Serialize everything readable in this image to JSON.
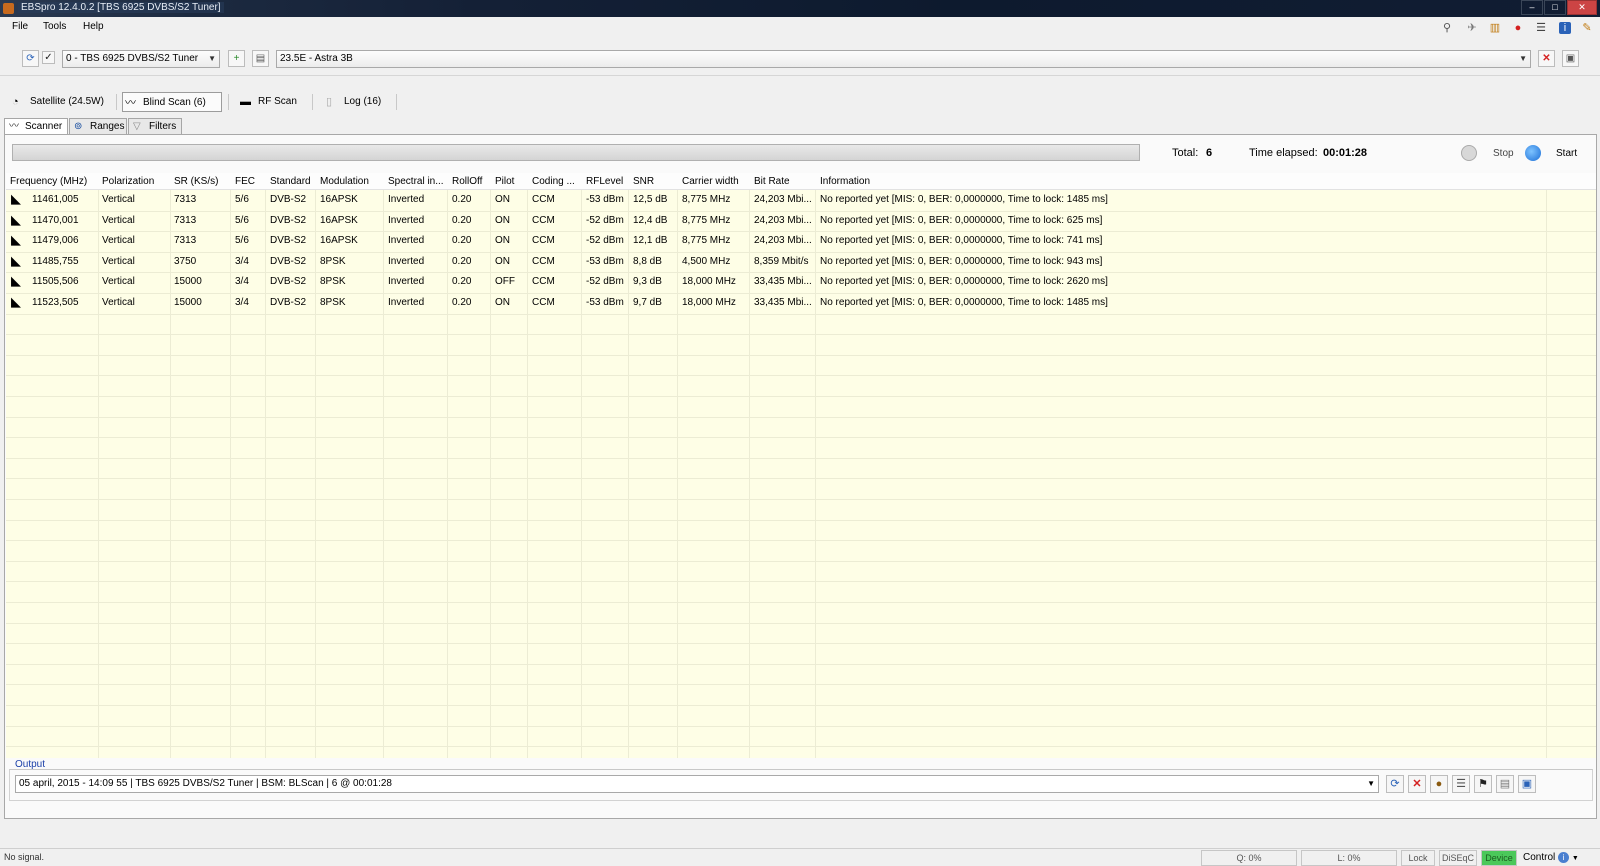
{
  "window": {
    "title": "EBSpro 12.4.0.2 [TBS 6925 DVBS/S2 Tuner]"
  },
  "menu": {
    "items": [
      "File",
      "Tools",
      "Help"
    ]
  },
  "toolbar": {
    "tuner_select": "0 - TBS 6925 DVBS/S2 Tuner",
    "satellite_select": "23.5E - Astra 3B"
  },
  "main_tabs": [
    {
      "label": "Satellite (24.5W)"
    },
    {
      "label": "Blind Scan (6)"
    },
    {
      "label": "RF Scan"
    },
    {
      "label": "Log (16)"
    }
  ],
  "sub_tabs": [
    {
      "label": "Scanner"
    },
    {
      "label": "Ranges"
    },
    {
      "label": "Filters"
    }
  ],
  "scan": {
    "progress": 0.0,
    "total_label": "Total:",
    "total_value": "6",
    "elapsed_label": "Time elapsed:",
    "elapsed_value": "00:01:28",
    "stop_label": "Stop",
    "start_label": "Start"
  },
  "table": {
    "headers": [
      "Frequency (MHz)",
      "Polarization",
      "SR (KS/s)",
      "FEC",
      "Standard",
      "Modulation",
      "Spectral in...",
      "RollOff",
      "Pilot",
      "Coding ...",
      "RFLevel",
      "SNR",
      "Carrier width",
      "Bit Rate",
      "Information"
    ],
    "rows": [
      [
        "11461,005",
        "Vertical",
        "7313",
        "5/6",
        "DVB-S2",
        "16APSK",
        "Inverted",
        "0.20",
        "ON",
        "CCM",
        "-53 dBm",
        "12,5 dB",
        "8,775 MHz",
        "24,203 Mbi...",
        "No reported yet [MIS: 0, BER: 0,0000000, Time to lock: 1485 ms]"
      ],
      [
        "11470,001",
        "Vertical",
        "7313",
        "5/6",
        "DVB-S2",
        "16APSK",
        "Inverted",
        "0.20",
        "ON",
        "CCM",
        "-52 dBm",
        "12,4 dB",
        "8,775 MHz",
        "24,203 Mbi...",
        "No reported yet [MIS: 0, BER: 0,0000000, Time to lock: 625 ms]"
      ],
      [
        "11479,006",
        "Vertical",
        "7313",
        "5/6",
        "DVB-S2",
        "16APSK",
        "Inverted",
        "0.20",
        "ON",
        "CCM",
        "-52 dBm",
        "12,1 dB",
        "8,775 MHz",
        "24,203 Mbi...",
        "No reported yet [MIS: 0, BER: 0,0000000, Time to lock: 741 ms]"
      ],
      [
        "11485,755",
        "Vertical",
        "3750",
        "3/4",
        "DVB-S2",
        "8PSK",
        "Inverted",
        "0.20",
        "ON",
        "CCM",
        "-53 dBm",
        "8,8 dB",
        "4,500 MHz",
        "8,359 Mbit/s",
        "No reported yet [MIS: 0, BER: 0,0000000, Time to lock: 943 ms]"
      ],
      [
        "11505,506",
        "Vertical",
        "15000",
        "3/4",
        "DVB-S2",
        "8PSK",
        "Inverted",
        "0.20",
        "OFF",
        "CCM",
        "-52 dBm",
        "9,3 dB",
        "18,000 MHz",
        "33,435 Mbi...",
        "No reported yet [MIS: 0, BER: 0,0000000, Time to lock: 2620 ms]"
      ],
      [
        "11523,505",
        "Vertical",
        "15000",
        "3/4",
        "DVB-S2",
        "8PSK",
        "Inverted",
        "0.20",
        "ON",
        "CCM",
        "-53 dBm",
        "9,7 dB",
        "18,000 MHz",
        "33,435 Mbi...",
        "No reported yet [MIS: 0, BER: 0,0000000, Time to lock: 1485 ms]"
      ]
    ]
  },
  "output": {
    "label": "Output",
    "value": "05 april, 2015 - 14:09 55 | TBS 6925 DVBS/S2 Tuner | BSM: BLScan | 6 @ 00:01:28"
  },
  "statusbar": {
    "signal": "No signal.",
    "quality": "Q: 0%",
    "level": "L: 0%",
    "lock": "Lock",
    "diseqc": "DiSEqC",
    "device": "Device",
    "control": "Control"
  },
  "colors": {
    "grid_bg": "#fefee6",
    "accent_blue": "#1a3fa8",
    "device_green": "#4bc85a",
    "close_red": "#d42020"
  }
}
